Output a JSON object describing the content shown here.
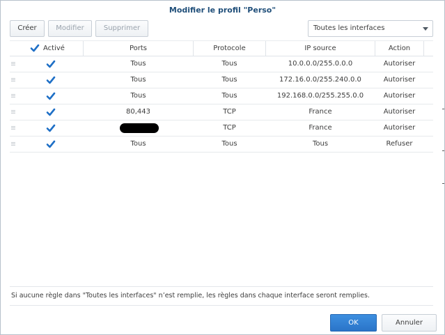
{
  "dialog": {
    "title": "Modifier le profil \"Perso\""
  },
  "toolbar": {
    "create_label": "Créer",
    "edit_label": "Modifier",
    "delete_label": "Supprimer"
  },
  "interface_select": {
    "selected": "Toutes les interfaces"
  },
  "table": {
    "headers": {
      "enabled": "Activé",
      "ports": "Ports",
      "protocol": "Protocole",
      "source_ip": "IP source",
      "action": "Action"
    },
    "rows": [
      {
        "enabled": true,
        "ports": "Tous",
        "protocol": "Tous",
        "source_ip": "10.0.0.0/255.0.0.0",
        "action": "Autoriser"
      },
      {
        "enabled": true,
        "ports": "Tous",
        "protocol": "Tous",
        "source_ip": "172.16.0.0/255.240.0.0",
        "action": "Autoriser"
      },
      {
        "enabled": true,
        "ports": "Tous",
        "protocol": "Tous",
        "source_ip": "192.168.0.0/255.255.0.0",
        "action": "Autoriser"
      },
      {
        "enabled": true,
        "ports": "80,443",
        "protocol": "TCP",
        "source_ip": "France",
        "action": "Autoriser"
      },
      {
        "enabled": true,
        "ports": "",
        "ports_redacted": true,
        "protocol": "TCP",
        "source_ip": "France",
        "action": "Autoriser"
      },
      {
        "enabled": true,
        "ports": "Tous",
        "protocol": "Tous",
        "source_ip": "Tous",
        "action": "Refuser"
      }
    ]
  },
  "hint": "Si aucune règle dans \"Toutes les interfaces\" n’est remplie, les règles dans chaque interface seront remplies.",
  "footer": {
    "ok_label": "OK",
    "cancel_label": "Annuler"
  },
  "colors": {
    "accent": "#2a74c8",
    "title": "#1f4e79",
    "check": "#1e6fc6"
  }
}
